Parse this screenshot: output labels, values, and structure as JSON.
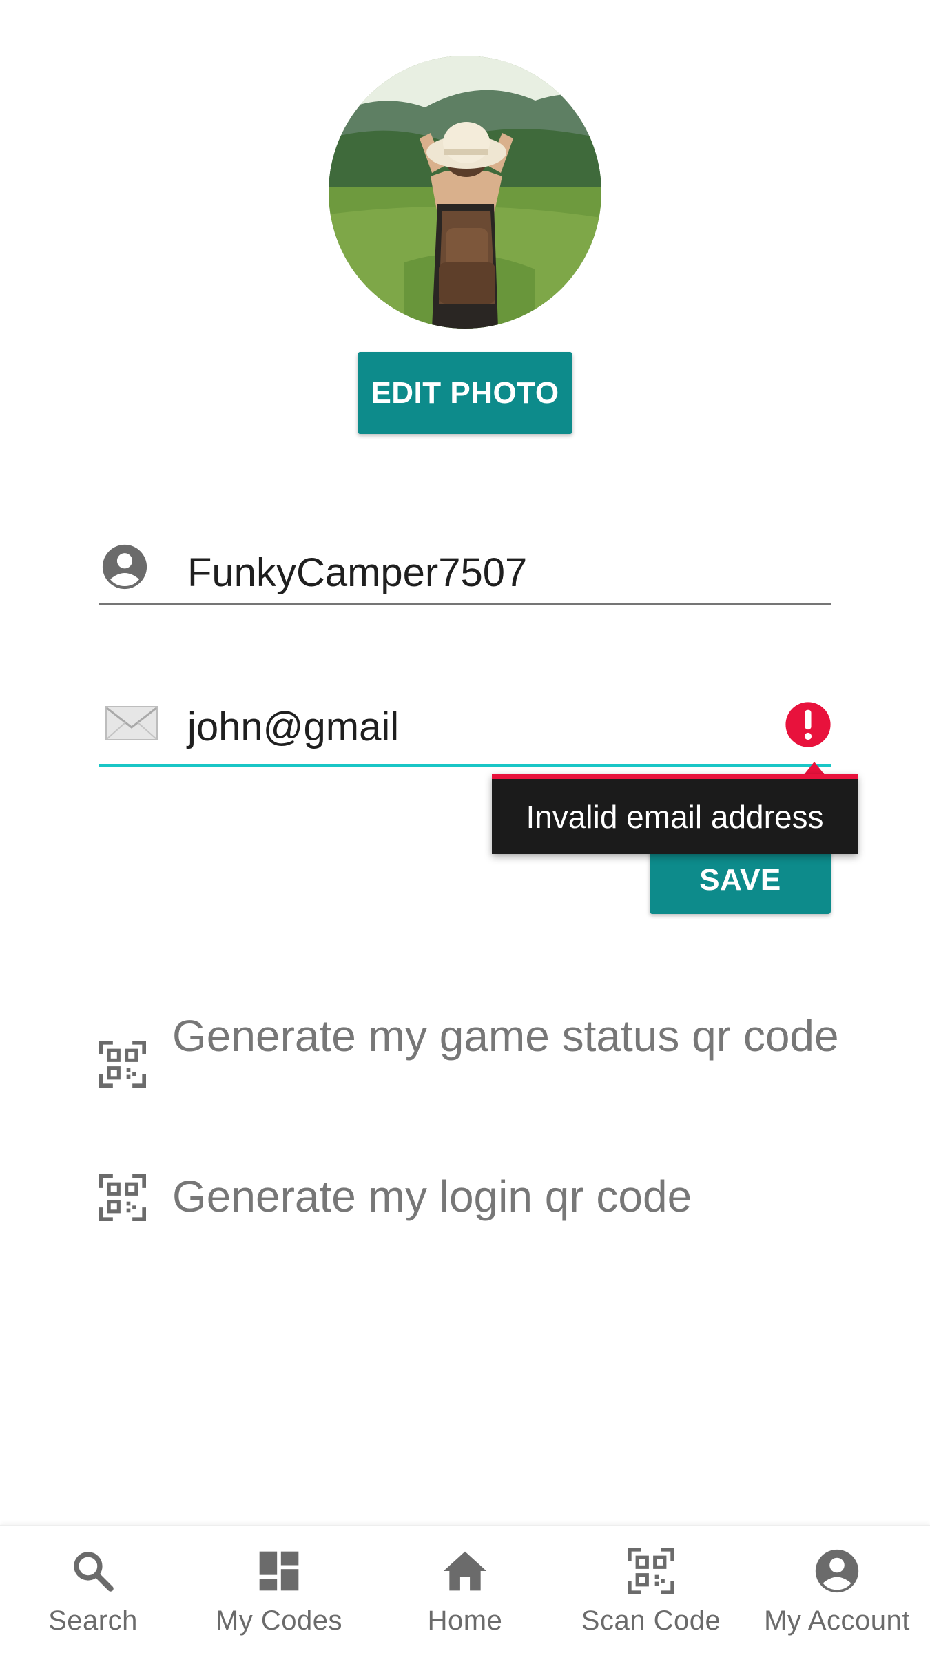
{
  "profile": {
    "edit_photo_label": "EDIT PHOTO",
    "username_value": "FunkyCamper7507",
    "email_value": "john@gmail",
    "email_error": "Invalid email address",
    "save_label": "SAVE"
  },
  "qr_actions": [
    {
      "label": "Generate my game status qr code",
      "icon": "qr-code-icon"
    },
    {
      "label": "Generate my login qr code",
      "icon": "qr-code-icon"
    }
  ],
  "bottom_nav": [
    {
      "label": "Search",
      "icon": "search-icon"
    },
    {
      "label": "My Codes",
      "icon": "dashboard-icon"
    },
    {
      "label": "Home",
      "icon": "home-icon"
    },
    {
      "label": "Scan Code",
      "icon": "qr-scan-icon"
    },
    {
      "label": "My Account",
      "icon": "account-circle-icon"
    }
  ],
  "colors": {
    "accent": "#0d8b8b",
    "focus_underline": "#19c6c6",
    "error": "#e8123c",
    "tooltip_bg": "#1b1b1b",
    "muted_text": "#777777"
  }
}
